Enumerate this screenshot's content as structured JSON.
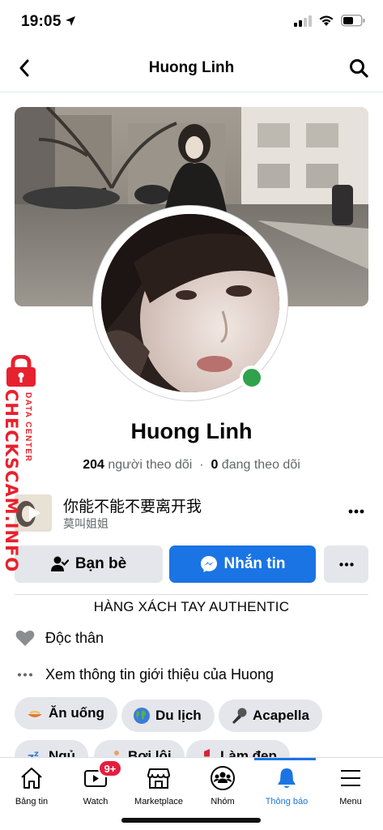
{
  "status_bar": {
    "time": "19:05"
  },
  "nav": {
    "title": "Huong Linh"
  },
  "profile": {
    "name": "Huong Linh",
    "followers_count": "204",
    "followers_label": "người theo dõi",
    "following_count": "0",
    "following_label": "đang theo dõi",
    "online": true
  },
  "music": {
    "title": "你能不能不要离开我",
    "artist": "莫叫姐姐"
  },
  "actions": {
    "friends_label": "Bạn bè",
    "message_label": "Nhắn tin"
  },
  "bio": "HÀNG XÁCH TAY AUTHENTIC",
  "intro": {
    "relationship": "Độc thân",
    "see_more": "Xem thông tin giới thiệu của Huong"
  },
  "hobbies": [
    {
      "label": "Ăn uống",
      "icon": "food-icon"
    },
    {
      "label": "Du lịch",
      "icon": "globe-icon"
    },
    {
      "label": "Acapella",
      "icon": "microphone-icon"
    },
    {
      "label": "Ngủ",
      "icon": "sleep-icon"
    },
    {
      "label": "Bơi lội",
      "icon": "swimming-icon"
    },
    {
      "label": "Làm đẹp",
      "icon": "lipstick-icon"
    }
  ],
  "tab_bar": {
    "tabs": [
      {
        "label": "Bảng tin",
        "icon": "home-icon"
      },
      {
        "label": "Watch",
        "icon": "watch-icon",
        "badge": "9+"
      },
      {
        "label": "Marketplace",
        "icon": "marketplace-icon"
      },
      {
        "label": "Nhóm",
        "icon": "groups-icon"
      },
      {
        "label": "Thông báo",
        "icon": "bell-icon",
        "active": true
      },
      {
        "label": "Menu",
        "icon": "menu-icon"
      }
    ]
  },
  "watermark": {
    "text": "CHECKSCAM.INFO",
    "subtext": "DATA CENTER"
  },
  "colors": {
    "accent": "#1b74e4",
    "online": "#31a24c",
    "badge": "#e41e3f",
    "watermark": "#e8212e"
  }
}
